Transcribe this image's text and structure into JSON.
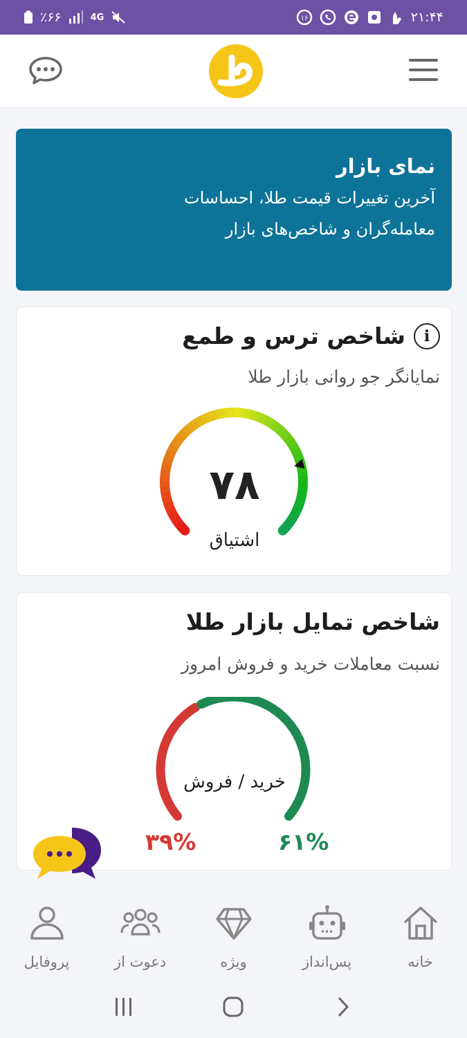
{
  "status_bar": {
    "time": "۲۱:۴۴",
    "battery": "٪۶۶",
    "network": "4G"
  },
  "banner": {
    "title": "نمای بازار",
    "line1": "آخرین تغییرات قیمت طلا، احساسات",
    "line2": "معامله‌گران و شاخص‌های بازار"
  },
  "fear_greed": {
    "title": "شاخص ترس و طمع",
    "subtitle": "نمایانگر جو روانی بازار طلا",
    "value": "۷۸",
    "value_numeric": 78,
    "label": "اشتیاق"
  },
  "trend": {
    "title": "شاخص تمایل بازار طلا",
    "subtitle": "نسبت معاملات خرید و فروش امروز",
    "center_label": "خرید / فروش",
    "sell_pct": "۳۹%",
    "buy_pct": "۶۱%",
    "sell_value": 39,
    "buy_value": 61
  },
  "nav": {
    "home": "خانه",
    "savings": "پس‌انداز",
    "special": "ویژه",
    "invite": "دعوت از",
    "profile": "پروفایل"
  },
  "colors": {
    "status_bar": "#6d51a5",
    "banner": "#0e7398",
    "logo": "#f5c518",
    "sell": "#d33a35",
    "buy": "#1e8a52"
  }
}
